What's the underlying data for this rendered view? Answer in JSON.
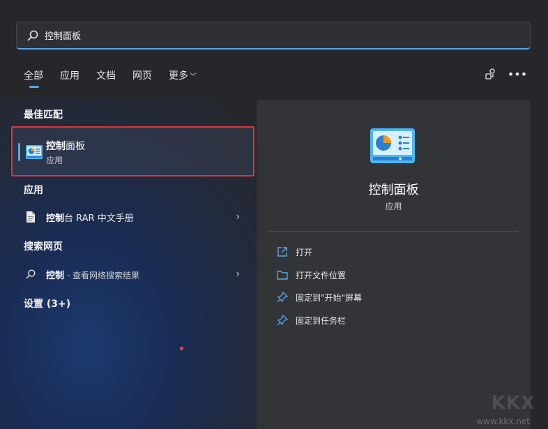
{
  "search": {
    "value": "控制面板"
  },
  "tabs": [
    {
      "label": "全部",
      "active": true
    },
    {
      "label": "应用"
    },
    {
      "label": "文档"
    },
    {
      "label": "网页"
    },
    {
      "label": "更多"
    }
  ],
  "sections": {
    "best_match": "最佳匹配",
    "apps": "应用",
    "web": "搜索网页",
    "settings": "设置 (3+)"
  },
  "best_match": {
    "name_bold": "控制",
    "name_rest": "面板",
    "type": "应用"
  },
  "apps_item": {
    "bold": "控制",
    "rest": "台 RAR 中文手册"
  },
  "web_item": {
    "bold": "控制",
    "rest": " - 查看网络搜索结果"
  },
  "preview": {
    "title": "控制面板",
    "subtitle": "应用",
    "actions": [
      {
        "label": "打开",
        "icon": "open-icon"
      },
      {
        "label": "打开文件位置",
        "icon": "folder-icon"
      },
      {
        "label": "固定到\"开始\"屏幕",
        "icon": "pin-icon"
      },
      {
        "label": "固定到任务栏",
        "icon": "pin-icon"
      }
    ]
  },
  "watermark": {
    "text": "KKX",
    "url": "www.kkx.net"
  },
  "colors": {
    "accent": "#5aa6e6",
    "highlight_border": "#d9363e"
  }
}
